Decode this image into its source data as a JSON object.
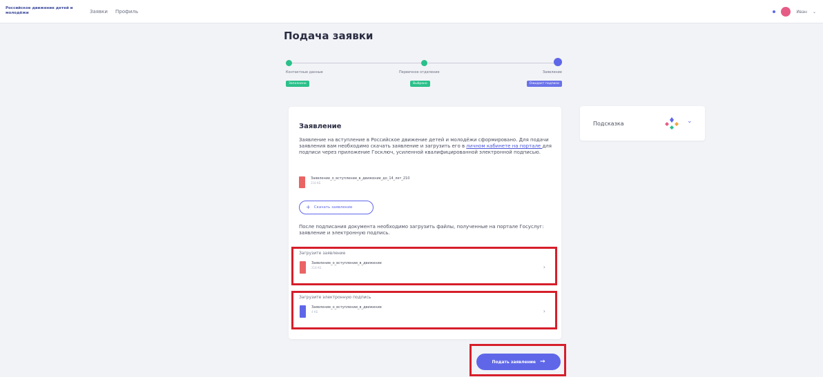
{
  "header": {
    "brand": "Российское движение детей и молодёжи",
    "nav": [
      "Заявки",
      "Профиль"
    ],
    "user_name": "Иван",
    "colors": {
      "accent": "#5f67e8",
      "success": "#2ac08a",
      "highlight": "#d61e2a"
    }
  },
  "page": {
    "title": "Подача заявки"
  },
  "stepper": {
    "steps": [
      {
        "label": "Контактные данные",
        "status": "Заполнено"
      },
      {
        "label": "Первичное отделение",
        "status": "Выбрано"
      },
      {
        "label": "Заявление",
        "status": "Ожидает подписи"
      }
    ]
  },
  "statement": {
    "title": "Заявление",
    "desc_part1": "Заявление на вступление в Российское движение детей и молодёжи сформировано. Для подачи заявления вам необходимо скачать заявление и загрузить его в ",
    "link": "личном кабинете на портале ",
    "desc_part2": "для подписи через приложение Госключ, усиленной квалифицированной электронной подписью.",
    "file": {
      "name": "Заявление_о_вступлении_в_движение_до_14_лет_210",
      "size": "218 КБ"
    },
    "download_button": "Скачать заявление",
    "after_text": "После подписания документа необходимо загрузить файлы, полученные на портале Госуслуг: заявление и электронную подпись."
  },
  "uploads": [
    {
      "label": "Загрузите заявление",
      "file_name": "Заявление_о_вступлении_в_движение",
      "file_size": "218 КБ"
    },
    {
      "label": "Загрузите электронную подпись",
      "file_name": "Заявление_о_вступлении_в_движение",
      "file_size": "4 КБ"
    }
  ],
  "submit": {
    "label": "Подать заявление",
    "arrow": "→"
  },
  "hint": {
    "label": "Подсказка",
    "chevron": "⌄"
  },
  "icons": {
    "chevron_right": "›",
    "chevron_down": "⌄",
    "plus": "+",
    "user_menu_chevron": "⌄"
  }
}
